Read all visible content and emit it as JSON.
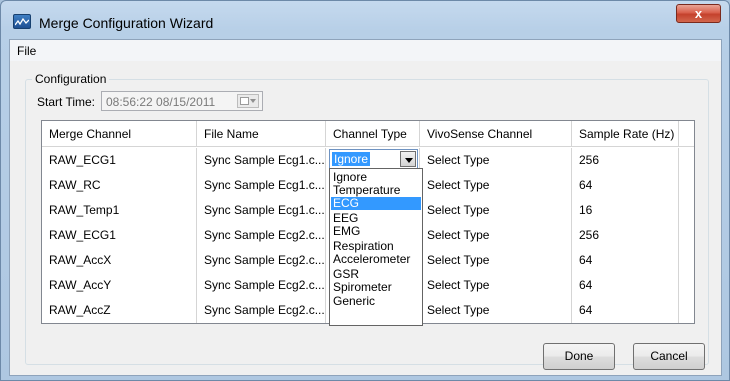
{
  "window": {
    "title": "Merge Configuration Wizard",
    "close_label": "x"
  },
  "menu": {
    "file": "File"
  },
  "config": {
    "legend": "Configuration",
    "start_time_label": "Start Time:",
    "start_time_value": "08:56:22 08/15/2011"
  },
  "table": {
    "columns": [
      "Merge Channel",
      "File Name",
      "Channel Type",
      "VivoSense Channel",
      "Sample Rate (Hz)"
    ],
    "rows": [
      [
        "RAW_ECG1",
        "Sync Sample Ecg1.c...",
        "Ignore",
        "Select Type",
        "256"
      ],
      [
        "RAW_RC",
        "Sync Sample Ecg1.c...",
        "",
        "Select Type",
        "64"
      ],
      [
        "RAW_Temp1",
        "Sync Sample Ecg1.c...",
        "",
        "Select Type",
        "16"
      ],
      [
        "RAW_ECG1",
        "Sync Sample Ecg2.c...",
        "",
        "Select Type",
        "256"
      ],
      [
        "RAW_AccX",
        "Sync Sample Ecg2.c...",
        "",
        "Select Type",
        "64"
      ],
      [
        "RAW_AccY",
        "Sync Sample Ecg2.c...",
        "",
        "Select Type",
        "64"
      ],
      [
        "RAW_AccZ",
        "Sync Sample Ecg2.c...",
        "",
        "Select Type",
        "64"
      ]
    ]
  },
  "channel_type_combo": {
    "value": "Ignore"
  },
  "channel_type_options": [
    "Ignore",
    "Temperature",
    "ECG",
    "EEG",
    "EMG",
    "Respiration",
    "Accelerometer",
    "GSR",
    "Spirometer",
    "Generic"
  ],
  "highlighted_option": "ECG",
  "buttons": {
    "done": "Done",
    "cancel": "Cancel"
  },
  "colors": {
    "selection": "#3399ff",
    "close_button": "#c4412c"
  }
}
